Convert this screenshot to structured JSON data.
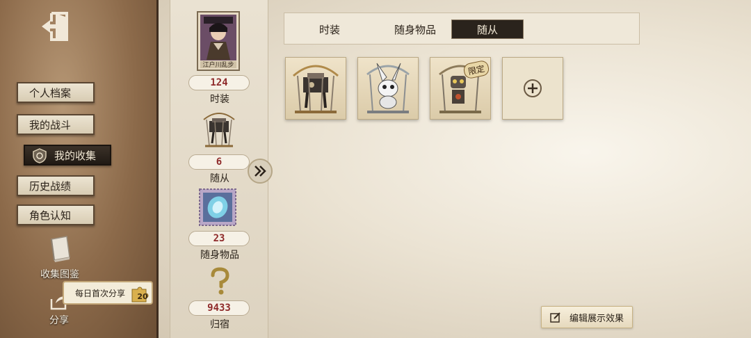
{
  "sidebar": {
    "nav": [
      {
        "label": "个人档案"
      },
      {
        "label": "我的战斗"
      },
      {
        "label": "我的收集",
        "active": true
      },
      {
        "label": "历史战绩"
      },
      {
        "label": "角色认知"
      }
    ],
    "collection_book_label": "收集图鉴",
    "share_label": "分享",
    "share_tip": "每日首次分享",
    "share_reward": "20"
  },
  "stats": {
    "portrait_name": "江户川乱步",
    "costume": {
      "count": "124",
      "label": "时装"
    },
    "pets": {
      "count": "6",
      "label": "随从"
    },
    "items": {
      "count": "23",
      "label": "随身物品"
    },
    "belonging": {
      "count": "9433",
      "label": "归宿"
    }
  },
  "tabs": [
    {
      "label": "时装"
    },
    {
      "label": "随身物品"
    },
    {
      "label": "随从",
      "active": true
    }
  ],
  "cards": [
    {
      "name": "mechanical-pet-cage"
    },
    {
      "name": "rabbit-pet-cage"
    },
    {
      "name": "robot-pet-cage",
      "badge": "限定"
    },
    {
      "name": "add-slot",
      "icon": "plus-icon"
    }
  ],
  "edit_button": "编辑展示效果",
  "colors": {
    "accent_dark": "#2a231c",
    "count_red": "#8f2b2b",
    "leather": "#8c6a4a"
  }
}
